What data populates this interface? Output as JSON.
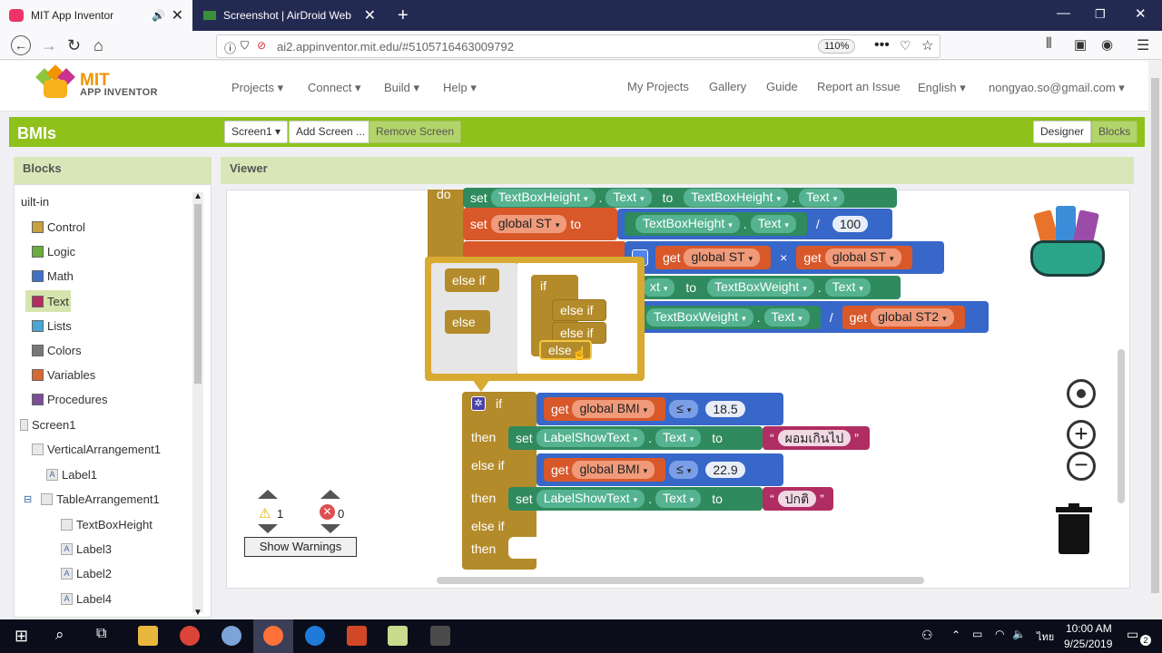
{
  "browser": {
    "tabs": [
      {
        "label": "MIT App Inventor",
        "active": true
      },
      {
        "label": "Screenshot | AirDroid Web",
        "active": false
      }
    ],
    "url": "ai2.appinventor.mit.edu/#5105716463009792",
    "zoom": "110%"
  },
  "header": {
    "logo_main": "MIT",
    "logo_sub": "APP INVENTOR",
    "menus": [
      "Projects ▾",
      "Connect ▾",
      "Build ▾",
      "Help ▾"
    ],
    "links": [
      "My Projects",
      "Gallery",
      "Guide",
      "Report an Issue",
      "English ▾",
      "nongyao.so@gmail.com ▾"
    ]
  },
  "toolbar": {
    "project": "BMIs",
    "screen_select": "Screen1 ▾",
    "add_screen": "Add Screen ...",
    "remove_screen": "Remove Screen",
    "designer": "Designer",
    "blocks": "Blocks"
  },
  "blocks_panel": {
    "title": "Blocks",
    "root": "uilt-in",
    "builtins": [
      {
        "label": "Control",
        "color": "#c8a13e"
      },
      {
        "label": "Logic",
        "color": "#6aac3d"
      },
      {
        "label": "Math",
        "color": "#3f72c4"
      },
      {
        "label": "Text",
        "color": "#b32d5e"
      },
      {
        "label": "Lists",
        "color": "#4aa6d6"
      },
      {
        "label": "Colors",
        "color": "#777777"
      },
      {
        "label": "Variables",
        "color": "#d66932"
      },
      {
        "label": "Procedures",
        "color": "#7c4e99"
      }
    ],
    "components": [
      "Screen1",
      "VerticalArrangement1",
      "Label1",
      "TableArrangement1",
      "TextBoxHeight",
      "Label3",
      "Label2",
      "Label4"
    ]
  },
  "viewer": {
    "title": "Viewer",
    "blocks": {
      "do": "do",
      "set": "set",
      "to": "to",
      "get": "get",
      "dot": ".",
      "text_prop": "Text",
      "textbox_height": "TextBoxHeight",
      "textbox_weight": "TextBoxWeight",
      "global_st": "global ST",
      "global_st2": "global ST2",
      "global_bmi": "global BMI",
      "label_show": "LabelShowText",
      "div": "/",
      "times": "×",
      "leq": "≤",
      "num_100": "100",
      "num_185": "18.5",
      "num_229": "22.9",
      "txt1": "ผอมเกินไป",
      "txt2": "ปกติ",
      "quote": "“",
      "quote_end": "”",
      "if": "if",
      "then": "then",
      "else_if": "else if",
      "else": "else",
      "partial_ext": "xt",
      "partial_st2": "global ST2"
    },
    "warnings": {
      "count": "1",
      "errors": "0",
      "button": "Show Warnings"
    }
  },
  "taskbar": {
    "time": "10:00 AM",
    "date": "9/25/2019",
    "lang": "ไทย",
    "notifications": "2"
  }
}
